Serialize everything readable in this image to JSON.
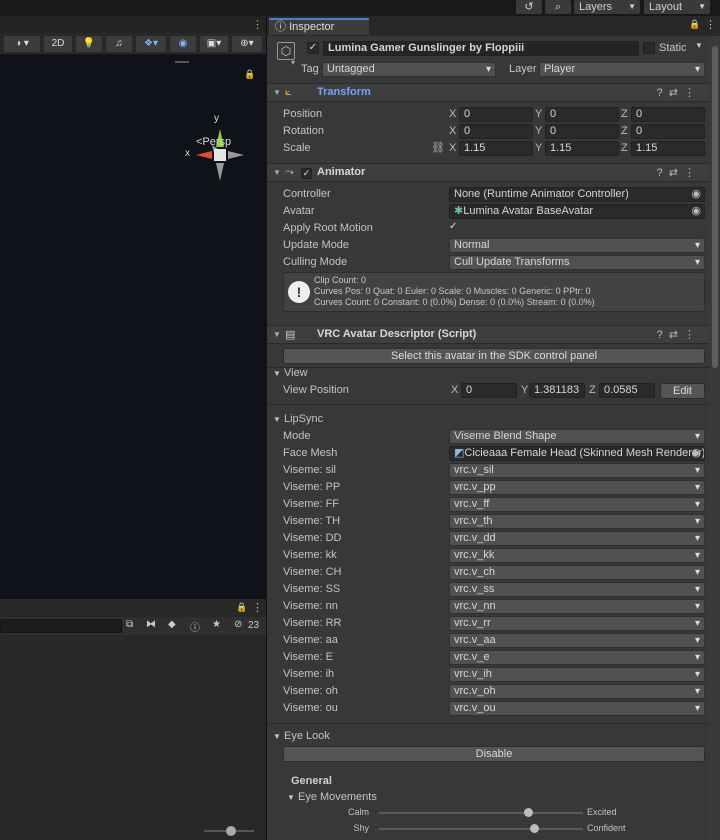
{
  "topbar": {
    "history_icon": "history-icon",
    "search_icon": "search-icon",
    "layers_label": "Layers",
    "layout_label": "Layout"
  },
  "scene": {
    "toolbar": {
      "mode_2d": "2D"
    },
    "gizmo": {
      "y_label": "y",
      "x_label": "x"
    },
    "persp_label": "<Persp",
    "lower_count": "23"
  },
  "inspector": {
    "tab_label": "Inspector",
    "object": {
      "name": "Lumina Gamer Gunslinger by Floppiii",
      "static_label": "Static",
      "tag_label": "Tag",
      "tag_value": "Untagged",
      "layer_label": "Layer",
      "layer_value": "Player"
    },
    "transform": {
      "title": "Transform",
      "rows": [
        {
          "label": "Position",
          "x": "0",
          "y": "0",
          "z": "0"
        },
        {
          "label": "Rotation",
          "x": "0",
          "y": "0",
          "z": "0"
        },
        {
          "label": "Scale",
          "x": "1.15",
          "y": "1.15",
          "z": "1.15"
        }
      ],
      "axis": {
        "x": "X",
        "y": "Y",
        "z": "Z"
      }
    },
    "animator": {
      "title": "Animator",
      "controller_label": "Controller",
      "controller_value": "None (Runtime Animator Controller)",
      "avatar_label": "Avatar",
      "avatar_value": "Lumina Avatar BaseAvatar",
      "apply_root_label": "Apply Root Motion",
      "apply_root_check": "✓",
      "update_mode_label": "Update Mode",
      "update_mode_value": "Normal",
      "culling_mode_label": "Culling Mode",
      "culling_mode_value": "Cull Update Transforms",
      "info_lines": [
        "Clip Count: 0",
        "Curves Pos: 0 Quat: 0 Euler: 0 Scale: 0 Muscles: 0 Generic: 0 PPtr: 0",
        "Curves Count: 0 Constant: 0 (0.0%) Dense: 0 (0.0%) Stream: 0 (0.0%)"
      ]
    },
    "vrc": {
      "title": "VRC Avatar Descriptor (Script)",
      "select_button": "Select this avatar in the SDK control panel",
      "view_section": "View",
      "view_position_label": "View Position",
      "view_x": "0",
      "view_y": "1.381183",
      "view_z": "0.0585",
      "edit_button": "Edit",
      "lipsync_section": "LipSync",
      "mode_label": "Mode",
      "mode_value": "Viseme Blend Shape",
      "face_mesh_label": "Face Mesh",
      "face_mesh_value": "Cicieaaa Female Head (Skinned Mesh Renderer)",
      "visemes": [
        {
          "label": "Viseme: sil",
          "value": "vrc.v_sil"
        },
        {
          "label": "Viseme: PP",
          "value": "vrc.v_pp"
        },
        {
          "label": "Viseme: FF",
          "value": "vrc.v_ff"
        },
        {
          "label": "Viseme: TH",
          "value": "vrc.v_th"
        },
        {
          "label": "Viseme: DD",
          "value": "vrc.v_dd"
        },
        {
          "label": "Viseme: kk",
          "value": "vrc.v_kk"
        },
        {
          "label": "Viseme: CH",
          "value": "vrc.v_ch"
        },
        {
          "label": "Viseme: SS",
          "value": "vrc.v_ss"
        },
        {
          "label": "Viseme: nn",
          "value": "vrc.v_nn"
        },
        {
          "label": "Viseme: RR",
          "value": "vrc.v_rr"
        },
        {
          "label": "Viseme: aa",
          "value": "vrc.v_aa"
        },
        {
          "label": "Viseme: E",
          "value": "vrc.v_e"
        },
        {
          "label": "Viseme: ih",
          "value": "vrc.v_ih"
        },
        {
          "label": "Viseme: oh",
          "value": "vrc.v_oh"
        },
        {
          "label": "Viseme: ou",
          "value": "vrc.v_ou"
        }
      ],
      "eye_look_section": "Eye Look",
      "disable_button": "Disable",
      "general_label": "General",
      "eye_movements_label": "Eye Movements",
      "sliders": [
        {
          "left": "Calm",
          "right": "Excited",
          "value": 0.73
        },
        {
          "left": "Shy",
          "right": "Confident",
          "value": 0.76
        }
      ]
    }
  }
}
